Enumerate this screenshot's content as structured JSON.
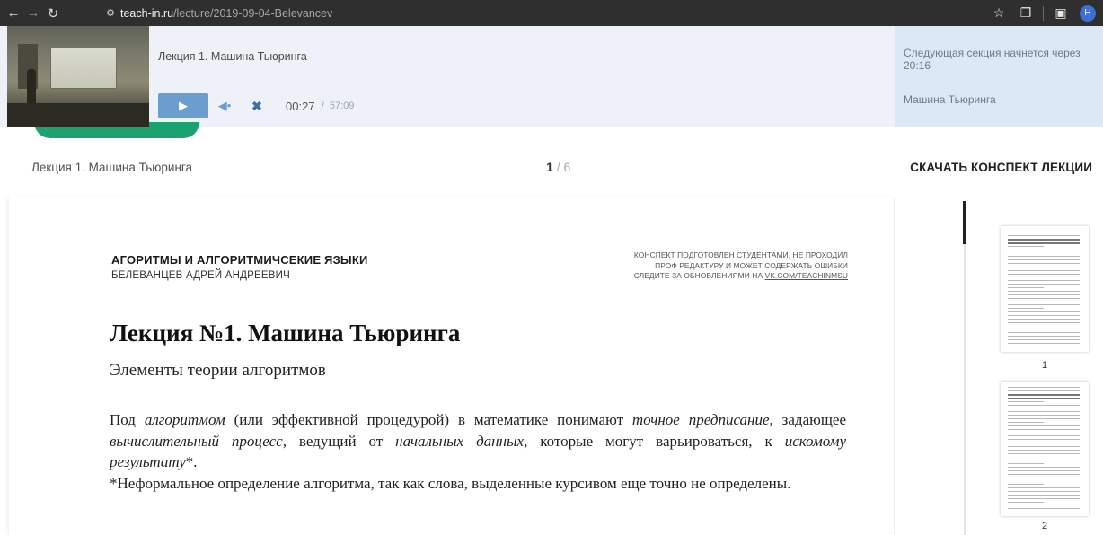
{
  "browser": {
    "url_host": "teach-in.ru",
    "url_path": "/lecture/2019-09-04-Belevancev",
    "profile_initial": "Н"
  },
  "player": {
    "title": "Лекция 1. Машина Тьюринга",
    "current_time": "00:27",
    "separator": "/",
    "total_time": "57:09",
    "next_section_text": "Следующая секция начнется через 20:16",
    "next_section_name": "Машина Тьюринга"
  },
  "page_header": {
    "lecture_title": "Лекция 1. Машина Тьюринга",
    "page_current": "1",
    "page_separator": "/ 6",
    "download_label": "СКАЧАТЬ КОНСПЕКТ ЛЕКЦИИ"
  },
  "document": {
    "course": "АГОРИТМЫ И АЛГОРИТМИЧСЕКИЕ ЯЗЫКИ",
    "author": "БЕЛЕВАНЦЕВ АДРЕЙ АНДРЕЕВИЧ",
    "note_line1": "КОНСПЕКТ ПОДГОТОВЛЕН СТУДЕНТАМИ, НЕ ПРОХОДИЛ",
    "note_line2": "ПРОФ РЕДАКТУРУ И МОЖЕТ СОДЕРЖАТЬ ОШИБКИ",
    "note_line3_prefix": "СЛЕДИТЕ ЗА ОБНОВЛЕНИЯМИ НА ",
    "note_link": "VK.COM/TEACHINMSU",
    "heading": "Лекция №1. Машина Тьюринга",
    "subheading": "Элементы теории алгоритмов",
    "para1": {
      "t1": "Под ",
      "i1": "алгоритмом",
      "t2": " (или эффективной процедурой) в математике понимают ",
      "i2": "точное предписание",
      "t3": ", задающее ",
      "i3": "вычислительный процесс",
      "t4": ", ведущий от ",
      "i4": "начальных данных",
      "t5": ", которые могут варьироваться, к ",
      "i5": "искомому результату",
      "t6": "*."
    },
    "para2": "*Неформальное определение алгоритма, так как слова, выделенные курсивом еще точно не определены."
  },
  "thumbnails": [
    {
      "number": "1"
    },
    {
      "number": "2"
    }
  ],
  "colors": {
    "play_button": "#6b9ecf",
    "player_bg": "#eef2f8",
    "next_panel_bg": "#dde8f6",
    "accent_green": "#1aa36f"
  },
  "icons": [
    "back-arrow-icon",
    "forward-arrow-icon",
    "reload-icon",
    "site-settings-icon",
    "star-icon",
    "extensions-icon",
    "sidebar-icon",
    "play-icon",
    "volume-icon",
    "fullscreen-icon"
  ]
}
